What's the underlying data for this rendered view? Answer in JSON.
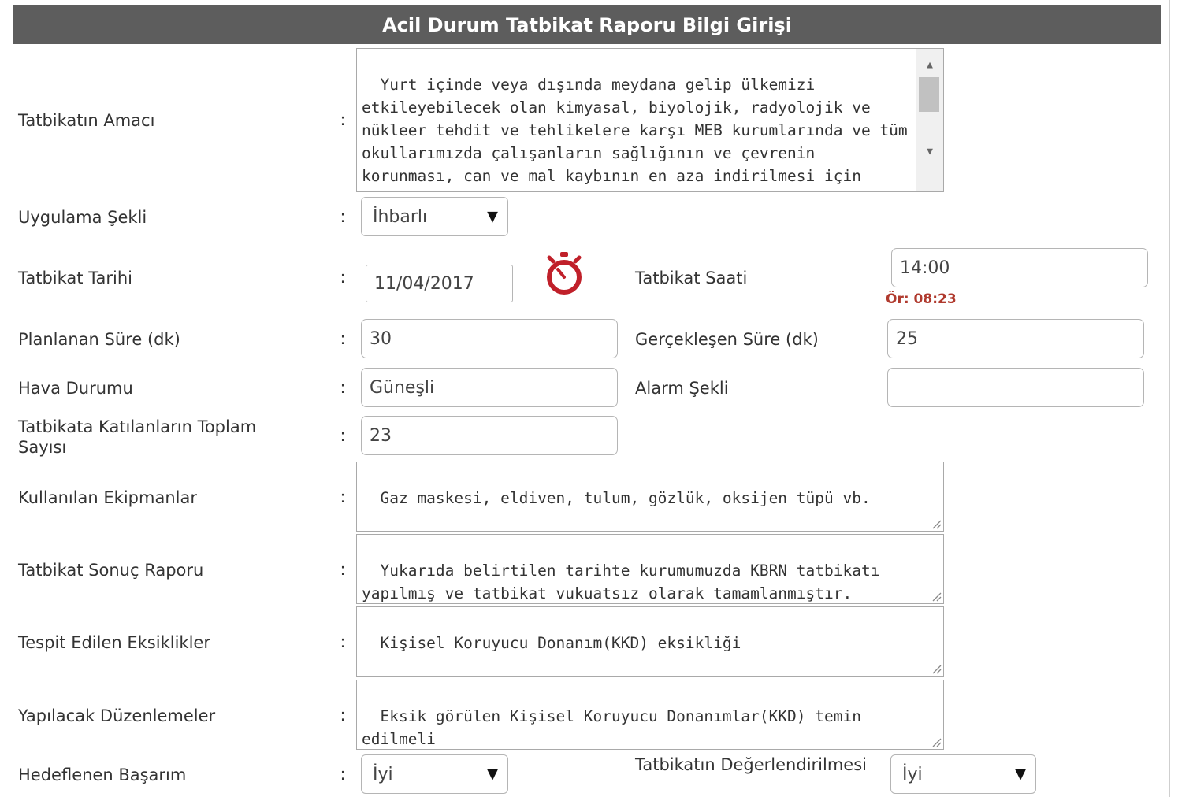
{
  "form": {
    "title": "Acil Durum Tatbikat Raporu Bilgi Girişi",
    "separator": ":",
    "purpose": {
      "label": "Tatbikatın Amacı",
      "value": "Yurt içinde veya dışında meydana gelip ülkemizi etkileyebilecek olan kimyasal, biyolojik, radyolojik ve nükleer tehdit ve tehlikelere karşı MEB kurumlarında ve tüm okullarımızda çalışanların sağlığının ve çevrenin korunması, can ve mal kaybının en aza indirilmesi için gerekli"
    },
    "application_type": {
      "label": "Uygulama Şekli",
      "value": "İhbarlı"
    },
    "drill_date": {
      "label": "Tatbikat Tarihi",
      "value": "11/04/2017"
    },
    "drill_time": {
      "label": "Tatbikat Saati",
      "value": "14:00",
      "hint": "Ör: 08:23"
    },
    "planned_duration": {
      "label": "Planlanan Süre (dk)",
      "value": "30"
    },
    "actual_duration": {
      "label": "Gerçekleşen Süre (dk)",
      "value": "25"
    },
    "weather": {
      "label": "Hava Durumu",
      "value": "Güneşli"
    },
    "alarm_type": {
      "label": "Alarm Şekli",
      "value": ""
    },
    "participants": {
      "label": "Tatbikata Katılanların Toplam Sayısı",
      "value": "23"
    },
    "equipment": {
      "label": "Kullanılan Ekipmanlar",
      "value": "Gaz maskesi, eldiven, tulum, gözlük, oksijen tüpü vb."
    },
    "result_report": {
      "label": "Tatbikat Sonuç Raporu",
      "value": "Yukarıda belirtilen tarihte kurumumuzda KBRN tatbikatı yapılmış ve tatbikat vukuatsız olarak tamamlanmıştır."
    },
    "deficiencies": {
      "label": "Tespit Edilen Eksiklikler",
      "value": "Kişisel Koruyucu Donanım(KKD) eksikliği"
    },
    "improvements": {
      "label": "Yapılacak Düzenlemeler",
      "value": "Eksik görülen Kişisel Koruyucu Donanımlar(KKD) temin edilmeli"
    },
    "target_performance": {
      "label": "Hedeflenen Başarım",
      "value": "İyi"
    },
    "evaluation": {
      "label": "Tatbikatın Değerlendirilmesi",
      "value": "İyi"
    }
  },
  "icons": {
    "dropdown_arrow": "▼",
    "clock": "stopwatch-icon"
  },
  "colors": {
    "header_bg": "#5d5d5d",
    "hint": "#b03a2e",
    "clock": "#c0202a"
  }
}
